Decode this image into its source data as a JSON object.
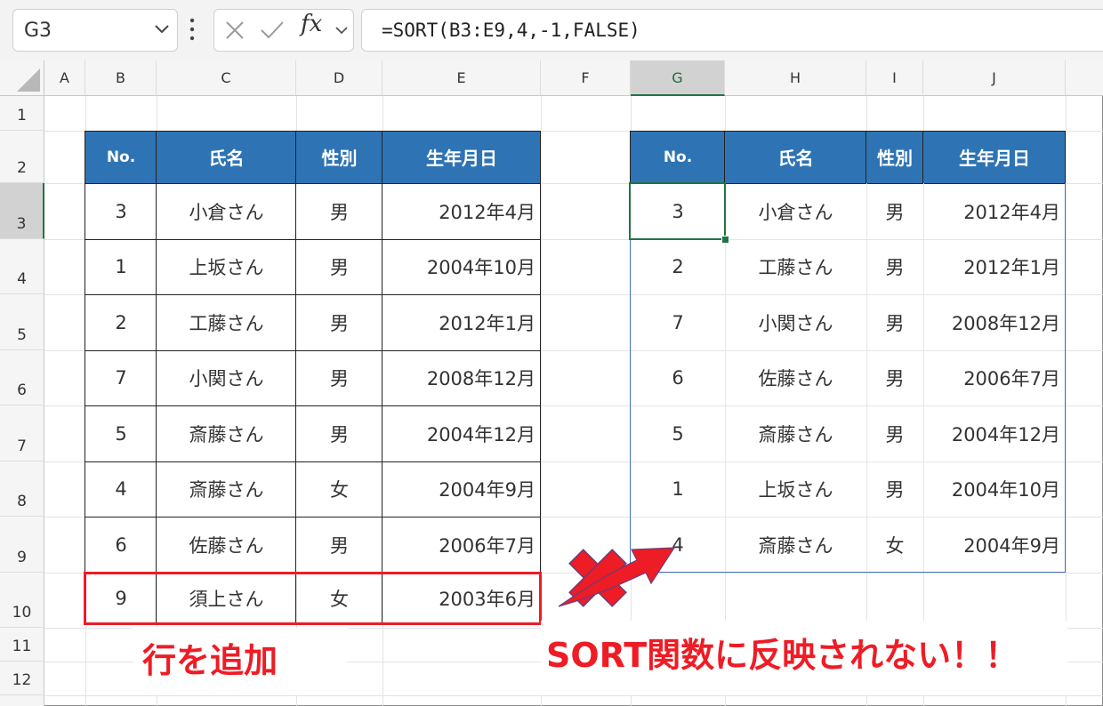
{
  "formula_bar": {
    "name_box": "G3",
    "fx_label": "fx",
    "formula": "=SORT(B3:E9,4,-1,FALSE)"
  },
  "columns": [
    "A",
    "B",
    "C",
    "D",
    "E",
    "F",
    "G",
    "H",
    "I",
    "J"
  ],
  "rows": [
    "1",
    "2",
    "3",
    "4",
    "5",
    "6",
    "7",
    "8",
    "9",
    "10",
    "11",
    "12"
  ],
  "source_table": {
    "headers": [
      "No.",
      "氏名",
      "性別",
      "生年月日"
    ],
    "rows": [
      [
        "3",
        "小倉さん",
        "男",
        "2012年4月"
      ],
      [
        "1",
        "上坂さん",
        "男",
        "2004年10月"
      ],
      [
        "2",
        "工藤さん",
        "男",
        "2012年1月"
      ],
      [
        "7",
        "小関さん",
        "男",
        "2008年12月"
      ],
      [
        "5",
        "斎藤さん",
        "男",
        "2004年12月"
      ],
      [
        "4",
        "斎藤さん",
        "女",
        "2004年9月"
      ],
      [
        "6",
        "佐藤さん",
        "男",
        "2006年7月"
      ],
      [
        "9",
        "須上さん",
        "女",
        "2003年6月"
      ]
    ]
  },
  "sorted_table": {
    "headers": [
      "No.",
      "氏名",
      "性別",
      "生年月日"
    ],
    "rows": [
      [
        "3",
        "小倉さん",
        "男",
        "2012年4月"
      ],
      [
        "2",
        "工藤さん",
        "男",
        "2012年1月"
      ],
      [
        "7",
        "小関さん",
        "男",
        "2008年12月"
      ],
      [
        "6",
        "佐藤さん",
        "男",
        "2006年7月"
      ],
      [
        "5",
        "斎藤さん",
        "男",
        "2004年12月"
      ],
      [
        "1",
        "上坂さん",
        "男",
        "2004年10月"
      ],
      [
        "4",
        "斎藤さん",
        "女",
        "2004年9月"
      ]
    ]
  },
  "annotations": {
    "added_row": "行を追加",
    "not_reflected": "SORT関数に反映されない！！",
    "color": "#ee1c25"
  },
  "colors": {
    "header_fill": "#2e74b5",
    "active_cell": "#217346",
    "spill_border": "#4472c4"
  }
}
